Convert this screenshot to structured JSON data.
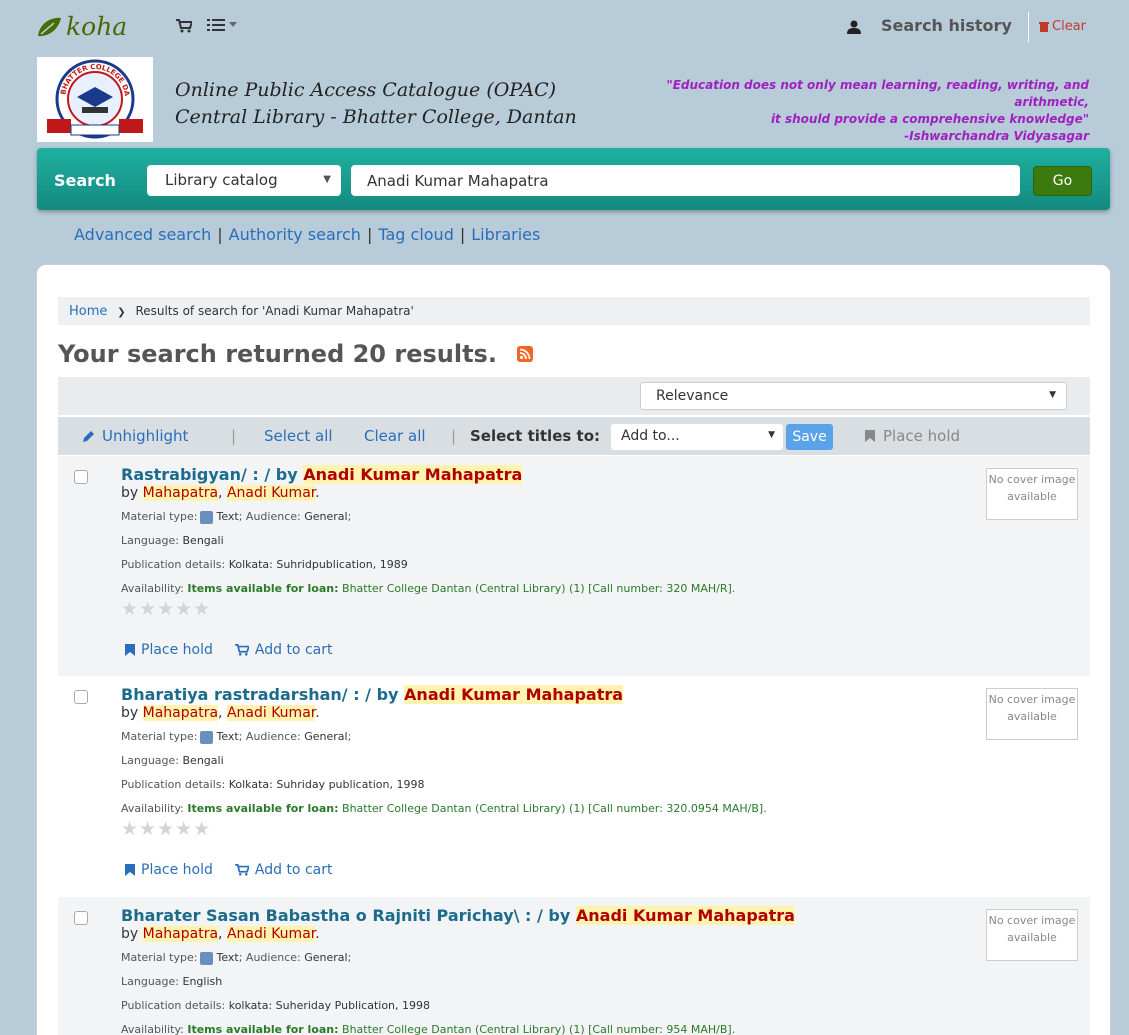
{
  "navbar": {
    "logo_text": "koha",
    "search_history": "Search history",
    "clear": "Clear"
  },
  "header": {
    "opac_line1": "Online Public Access Catalogue (OPAC)",
    "opac_line2": "Central Library - Bhatter College, Dantan",
    "quote_line1": "\"Education does not only mean learning, reading, writing, and",
    "quote_line2": "arithmetic,",
    "quote_line3": "it should provide a comprehensive knowledge\"",
    "quote_author": "-Ishwarchandra Vidyasagar",
    "logo_text": "BHATTER COLLEGE DANTAN"
  },
  "search": {
    "label": "Search",
    "catalog": "Library catalog",
    "query": "Anadi Kumar Mahapatra",
    "go": "Go"
  },
  "links": {
    "advanced": "Advanced search",
    "authority": "Authority search",
    "tagcloud": "Tag cloud",
    "libraries": "Libraries"
  },
  "breadcrumb": {
    "home": "Home",
    "current": "Results of search for 'Anadi Kumar Mahapatra'"
  },
  "results_heading": "Your search returned 20 results.",
  "sort": {
    "selected": "Relevance"
  },
  "toolbar": {
    "unhighlight": "Unhighlight",
    "select_all": "Select all",
    "clear_all": "Clear all",
    "select_titles": "Select titles to:",
    "add_to": "Add to...",
    "save": "Save",
    "place_hold": "Place hold"
  },
  "results": [
    {
      "title": "Rastrabigyan/ : / by",
      "title_hl": "Anadi Kumar Mahapatra",
      "by": "by",
      "author_last": "Mahapatra",
      "author_first": "Anadi Kumar",
      "material_label": "Material type:",
      "material": "Text",
      "audience_label": "; Audience:",
      "audience": "General",
      "language_label": "Language:",
      "language": "Bengali",
      "pub_label": "Publication details:",
      "pub": "Kolkata: Suhridpublication, 1989",
      "avail_label": "Availability:",
      "avail_strong": "Items available for loan:",
      "avail": "Bhatter College Dantan (Central Library) (1) [Call number: 320 MAH/R].",
      "cover": "No cover image available",
      "place_hold": "Place hold",
      "add_to_cart": "Add to cart"
    },
    {
      "title": "Bharatiya rastradarshan/ : / by",
      "title_hl": "Anadi Kumar Mahapatra",
      "by": "by",
      "author_last": "Mahapatra",
      "author_first": "Anadi Kumar",
      "material_label": "Material type:",
      "material": "Text",
      "audience_label": "; Audience:",
      "audience": "General",
      "language_label": "Language:",
      "language": "Bengali",
      "pub_label": "Publication details:",
      "pub": "Kolkata: Suhriday publication, 1998",
      "avail_label": "Availability:",
      "avail_strong": "Items available for loan:",
      "avail": "Bhatter College Dantan (Central Library) (1) [Call number: 320.0954 MAH/B].",
      "cover": "No cover image available",
      "place_hold": "Place hold",
      "add_to_cart": "Add to cart"
    },
    {
      "title": "Bharater Sasan Babastha o Rajniti Parichay\\ : / by",
      "title_hl": "Anadi Kumar Mahapatra",
      "by": "by",
      "author_last": "Mahapatra",
      "author_first": "Anadi Kumar",
      "material_label": "Material type:",
      "material": "Text",
      "audience_label": "; Audience:",
      "audience": "General",
      "language_label": "Language:",
      "language": "English",
      "pub_label": "Publication details:",
      "pub": "kolkata: Suheriday Publication, 1998",
      "avail_label": "Availability:",
      "avail_strong": "Items available for loan:",
      "avail": "Bhatter College Dantan (Central Library) (1) [Call number: 954 MAH/B].",
      "cover": "No cover image available"
    }
  ]
}
